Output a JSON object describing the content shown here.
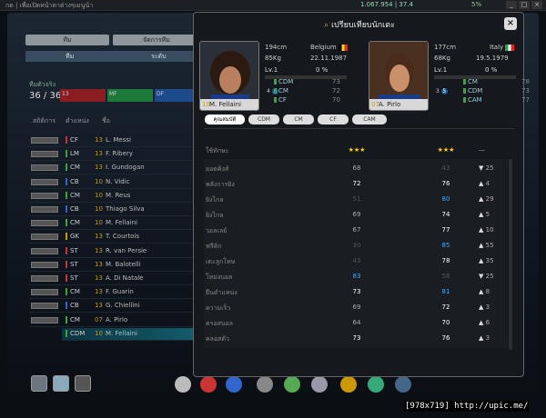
{
  "topbar": {
    "left": "กด | เพื่อเปิดหน้าตาต่างๆเมนูน้า",
    "right": "1.067.954 | 37.4",
    "pct": "5%"
  },
  "tabs": {
    "t1": "ทีม",
    "t2": "จัดการทีม",
    "s1": "ทีม",
    "s2": "ระดับ"
  },
  "team": {
    "label": "ทีมตัวจริง",
    "count": "36 / 36",
    "bars": [
      "13",
      "MF",
      "DF"
    ]
  },
  "list_header": {
    "a": "สถิติการ",
    "b": "ตำแหน่ง",
    "c": "ชื่อ"
  },
  "players": [
    {
      "pos": "CF",
      "num": "13",
      "name": "L. Messi",
      "c": "#c33"
    },
    {
      "pos": "LM",
      "num": "13",
      "name": "F. Ribery",
      "c": "#3a3"
    },
    {
      "pos": "CM",
      "num": "13",
      "name": "I. Gundogan",
      "c": "#3a3"
    },
    {
      "pos": "CB",
      "num": "10",
      "name": "N. Vidic",
      "c": "#36c"
    },
    {
      "pos": "CM",
      "num": "10",
      "name": "M. Reus",
      "c": "#3a3"
    },
    {
      "pos": "CB",
      "num": "10",
      "name": "Thiago Silva",
      "c": "#36c"
    },
    {
      "pos": "CM",
      "num": "10",
      "name": "M. Fellaini",
      "c": "#3a3"
    },
    {
      "pos": "GK",
      "num": "13",
      "name": "T. Courtois",
      "c": "#c90"
    },
    {
      "pos": "ST",
      "num": "13",
      "name": "R. van Persie",
      "c": "#c33"
    },
    {
      "pos": "ST",
      "num": "13",
      "name": "M. Balotelli",
      "c": "#c33"
    },
    {
      "pos": "ST",
      "num": "13",
      "name": "A. Di Natale",
      "c": "#c33"
    },
    {
      "pos": "CM",
      "num": "13",
      "name": "F. Guarin",
      "c": "#3a3"
    },
    {
      "pos": "CB",
      "num": "13",
      "name": "G. Chiellini",
      "c": "#36c"
    },
    {
      "pos": "CM",
      "num": "07",
      "name": "A. Pirlo",
      "c": "#3a3"
    },
    {
      "pos": "CDM",
      "num": "10",
      "name": "M. Fellaini",
      "c": "#3a3"
    }
  ],
  "popup": {
    "title": "เปรียบเทียบนักเตะ",
    "left": {
      "name": "M. Fellaini",
      "num": "10",
      "height": "194cm",
      "weight": "85Kg",
      "country": "Belgium",
      "dob": "22.11.1987",
      "lv": "Lv.1",
      "pct": "0 %",
      "s1": "4",
      "s2": "5",
      "pos": [
        [
          "CDM",
          "73"
        ],
        [
          "CM",
          "72"
        ],
        [
          "CF",
          "70"
        ]
      ]
    },
    "right": {
      "name": "A. Pirlo",
      "num": "07",
      "height": "177cm",
      "weight": "68Kg",
      "country": "Italy",
      "dob": "19.5.1979",
      "lv": "Lv.1",
      "pct": "0 %",
      "s1": "3",
      "s2": "5",
      "pos": [
        [
          "CM",
          "78"
        ],
        [
          "CDM",
          "73"
        ],
        [
          "CAM",
          "77"
        ]
      ]
    },
    "pos_tabs": [
      "คุณสมบัติ",
      "CDM",
      "CM",
      "CF",
      "CAM"
    ],
    "stars_row": {
      "label": "ใช้ทักษะ",
      "a": "★★★",
      "b": "★★★",
      "d": "—"
    },
    "stats": [
      {
        "label": "ยอดคิงส์",
        "a": "68",
        "b": "43",
        "d": "25",
        "dir": "▼",
        "ac": "#aaa",
        "bc": "#555"
      },
      {
        "label": "พลังการยิง",
        "a": "72",
        "b": "76",
        "d": "4",
        "dir": "▲",
        "ac": "#fff",
        "bc": "#fff"
      },
      {
        "label": "ยิงไกล",
        "a": "51",
        "b": "80",
        "d": "29",
        "dir": "▲",
        "ac": "#555",
        "bc": "#4af"
      },
      {
        "label": "ยิงไกล",
        "a": "69",
        "b": "74",
        "d": "5",
        "dir": "▲",
        "ac": "#aaa",
        "bc": "#fff"
      },
      {
        "label": "วอลเลย์",
        "a": "67",
        "b": "77",
        "d": "10",
        "dir": "▲",
        "ac": "#aaa",
        "bc": "#fff"
      },
      {
        "label": "ฟรีคิก",
        "a": "30",
        "b": "85",
        "d": "55",
        "dir": "▲",
        "ac": "#555",
        "bc": "#4af"
      },
      {
        "label": "เตะลูกโทษ",
        "a": "43",
        "b": "78",
        "d": "35",
        "dir": "▲",
        "ac": "#555",
        "bc": "#fff"
      },
      {
        "label": "โหม่งบอล",
        "a": "83",
        "b": "58",
        "d": "25",
        "dir": "▼",
        "ac": "#4af",
        "bc": "#555"
      },
      {
        "label": "ยืนตำแหน่ง",
        "a": "73",
        "b": "81",
        "d": "8",
        "dir": "▲",
        "ac": "#fff",
        "bc": "#4af"
      },
      {
        "label": "ความเร็ว",
        "a": "69",
        "b": "72",
        "d": "3",
        "dir": "▲",
        "ac": "#aaa",
        "bc": "#fff"
      },
      {
        "label": "ครอสบอล",
        "a": "64",
        "b": "70",
        "d": "6",
        "dir": "▲",
        "ac": "#aaa",
        "bc": "#fff"
      },
      {
        "label": "คลอสตัว",
        "a": "73",
        "b": "76",
        "d": "3",
        "dir": "▲",
        "ac": "#fff",
        "bc": "#fff"
      }
    ]
  },
  "watermark": "[978x719] http://upic.me/"
}
